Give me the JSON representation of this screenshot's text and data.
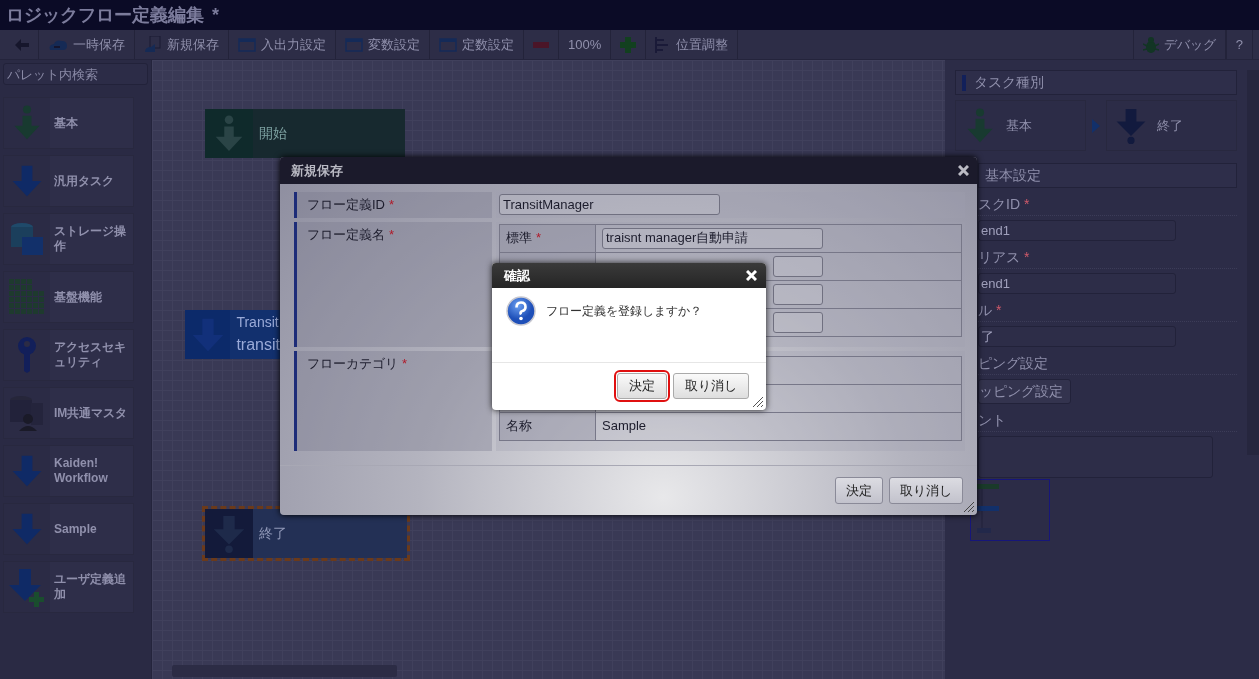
{
  "window": {
    "title": "ロジックフロー定義編集",
    "modified_mark": "*"
  },
  "toolbar": {
    "left": [
      {
        "kind": "back"
      },
      {
        "kind": "save",
        "label": "一時保存"
      },
      {
        "kind": "saveas",
        "label": "新規保存"
      },
      {
        "kind": "window",
        "label": "入出力設定"
      },
      {
        "kind": "window",
        "label": "変数設定"
      },
      {
        "kind": "window",
        "label": "定数設定"
      },
      {
        "kind": "zoom-out"
      },
      {
        "kind": "text",
        "label": "100%"
      },
      {
        "kind": "zoom-in"
      },
      {
        "kind": "align",
        "label": "位置調整"
      }
    ],
    "right": [
      {
        "kind": "debug",
        "label": "デバッグ"
      },
      {
        "kind": "text",
        "label": "?"
      }
    ]
  },
  "palette": {
    "search": {
      "placeholder": "パレット内検索"
    },
    "items": [
      {
        "kind": "start",
        "label": "基本"
      },
      {
        "kind": "task",
        "label": "汎用タスク"
      },
      {
        "kind": "storage",
        "label": "ストレージ操作"
      },
      {
        "kind": "grid",
        "label": "基盤機能"
      },
      {
        "kind": "key",
        "label": "アクセスセキュリティ"
      },
      {
        "kind": "dbuser",
        "label": "IM共通マスタ"
      },
      {
        "kind": "task",
        "label": "Kaiden! Workflow"
      },
      {
        "kind": "task",
        "label": "Sample"
      },
      {
        "kind": "add",
        "label": "ユーザ定義追加"
      }
    ]
  },
  "canvas": {
    "nodes": [
      {
        "kind": "start",
        "label": "開始",
        "selected": false
      },
      {
        "kind": "task",
        "label": "Transit",
        "sublabel": "transit",
        "selected": false
      },
      {
        "kind": "end",
        "label": "終了",
        "selected": true
      }
    ]
  },
  "properties": {
    "task_type": {
      "heading": "タスク種別",
      "from": {
        "kind": "start",
        "label": "基本"
      },
      "to": {
        "kind": "end",
        "label": "終了"
      }
    },
    "basic": {
      "heading": "基本設定",
      "fields": [
        {
          "kind": "input",
          "label": "スクID",
          "required_mark": "*",
          "value": "end1"
        },
        {
          "kind": "input",
          "label": "リアス",
          "required_mark": "*",
          "value": "end1"
        },
        {
          "kind": "input",
          "label": "ル",
          "required_mark": "*",
          "value": "了"
        },
        {
          "kind": "button",
          "label": "ピング設定",
          "value": "ッピング設定"
        },
        {
          "kind": "textarea",
          "label": "ント"
        }
      ]
    }
  },
  "save_dialog": {
    "title": "新規保存",
    "rows": [
      {
        "kind": "input",
        "label": "フロー定義ID",
        "required_mark": "*",
        "value": "TransitManager"
      },
      {
        "kind": "names",
        "label": "フロー定義名",
        "required_mark": "*",
        "items": [
          {
            "kind": "field",
            "label": "標準",
            "required_mark": "*",
            "value": "traisnt manager自動申請"
          },
          {
            "kind": "field"
          },
          {
            "kind": "field"
          },
          {
            "kind": "field"
          }
        ]
      },
      {
        "kind": "category",
        "label": "フローカテゴリ",
        "required_mark": "*",
        "items": [
          {
            "kind": "text"
          },
          {
            "kind": "text"
          },
          {
            "kind": "text",
            "label": "名称",
            "value": "Sample"
          }
        ]
      }
    ],
    "buttons": [
      {
        "label": "決定"
      },
      {
        "label": "取り消し"
      }
    ]
  },
  "confirm_dialog": {
    "title": "確認",
    "message": "フロー定義を登録しますか？",
    "buttons": [
      {
        "label": "決定",
        "focused": true
      },
      {
        "label": "取り消し",
        "focused": false
      }
    ]
  }
}
